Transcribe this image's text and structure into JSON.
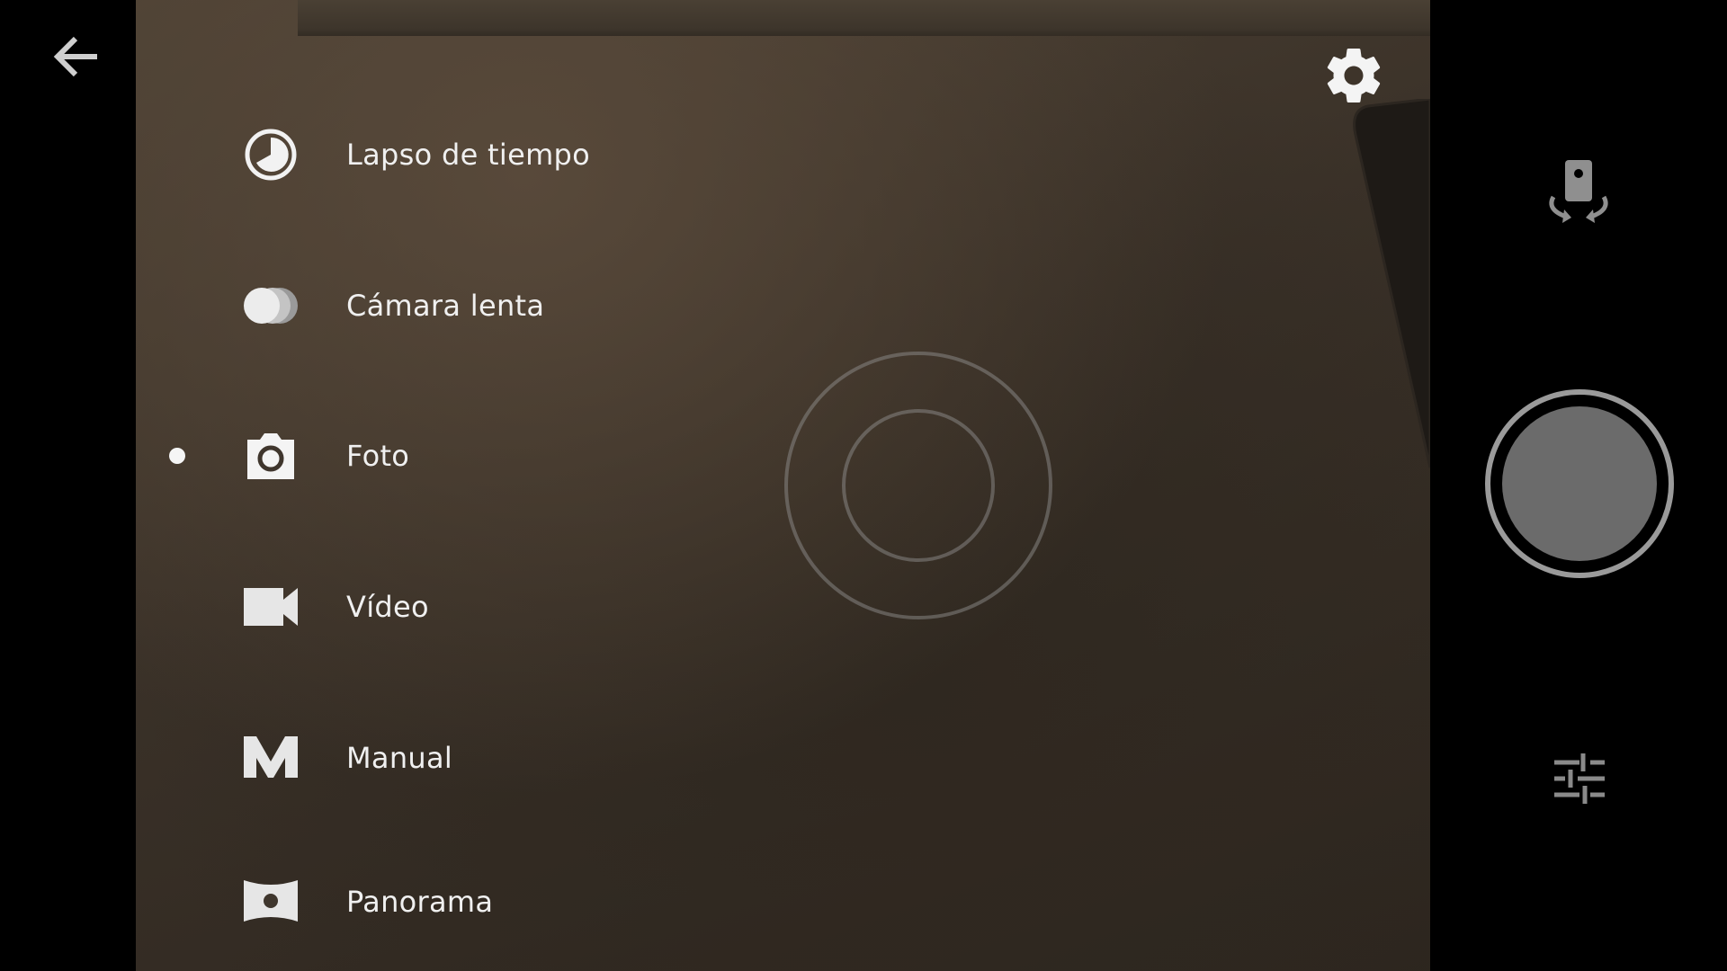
{
  "navigation": {
    "back_icon": "arrow-back-icon"
  },
  "toolbar": {
    "settings_icon": "gear-icon"
  },
  "modes": [
    {
      "label": "Lapso de tiempo",
      "icon": "timelapse-icon",
      "selected": false
    },
    {
      "label": "Cámara lenta",
      "icon": "slow-motion-icon",
      "selected": false
    },
    {
      "label": "Foto",
      "icon": "camera-icon",
      "selected": true
    },
    {
      "label": "Vídeo",
      "icon": "videocam-icon",
      "selected": false
    },
    {
      "label": "Manual",
      "icon": "manual-m-icon",
      "selected": false
    },
    {
      "label": "Panorama",
      "icon": "panorama-icon",
      "selected": false
    }
  ],
  "controls": {
    "switch_camera_icon": "switch-camera-icon",
    "shutter_icon": "shutter-icon",
    "adjust_icon": "tune-icon"
  },
  "colors": {
    "icon_light": "#f2f2f2",
    "icon_dim": "#8a8a8a",
    "shutter_fill": "#6b6b6b",
    "shutter_ring": "#9a9a9a"
  }
}
